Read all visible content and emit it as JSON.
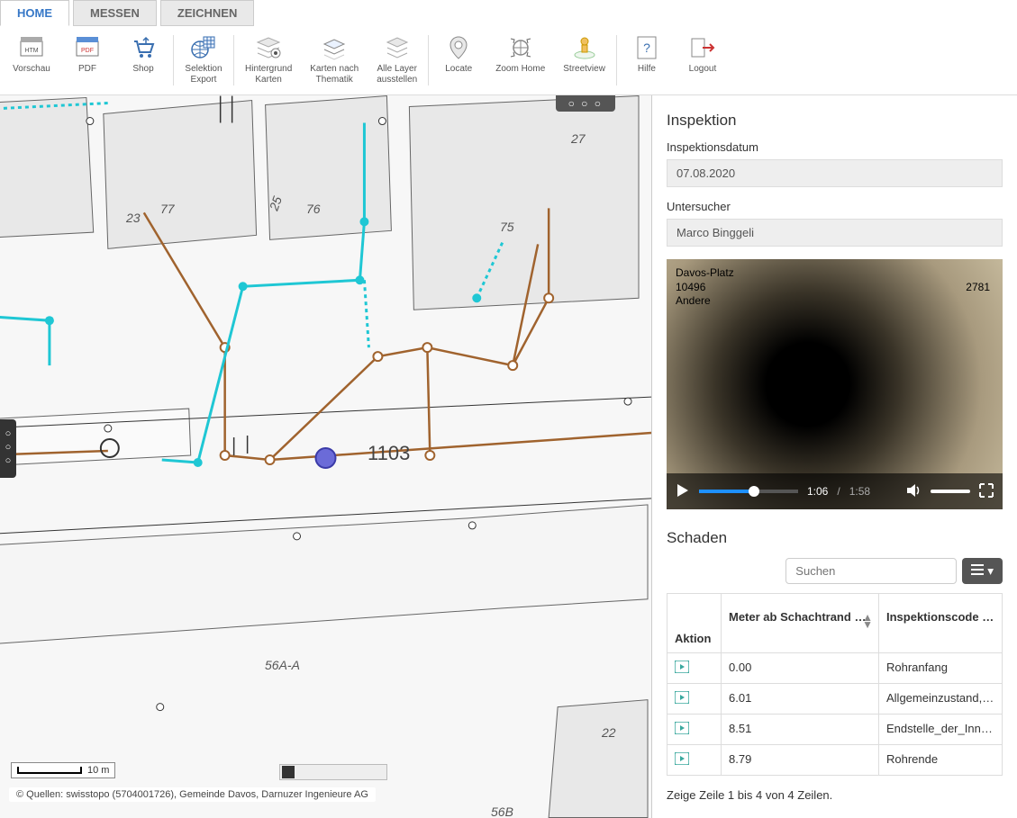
{
  "tabs": {
    "home": "HOME",
    "messen": "MESSEN",
    "zeichnen": "ZEICHNEN"
  },
  "toolbar": {
    "vorschau": "Vorschau",
    "pdf": "PDF",
    "shop": "Shop",
    "selektion": "Selektion\nExport",
    "hintergrund": "Hintergrund\nKarten",
    "karten_nach": "Karten nach\nThematik",
    "alle_layer": "Alle Layer\nausstellen",
    "locate": "Locate",
    "zoom_home": "Zoom Home",
    "streetview": "Streetview",
    "hilfe": "Hilfe",
    "logout": "Logout"
  },
  "map": {
    "feature_id": "1103",
    "parcels": {
      "p23": "23",
      "p77": "77",
      "p25": "25",
      "p76": "76",
      "p75": "75",
      "p27": "27",
      "p56a": "56A-A",
      "p56b": "56B",
      "p22": "22"
    },
    "scale": "10 m",
    "credits": "© Quellen: swisstopo (5704001726), Gemeinde Davos, Darnuzer Ingenieure AG"
  },
  "inspektion": {
    "title": "Inspektion",
    "datum_label": "Inspektionsdatum",
    "datum_value": "07.08.2020",
    "untersucher_label": "Untersucher",
    "untersucher_value": "Marco Binggeli"
  },
  "video": {
    "loc1": "Davos-Platz",
    "loc2": "10496",
    "loc3": "Andere",
    "right": "2781",
    "current": "1:06",
    "total": "1:58"
  },
  "schaden": {
    "title": "Schaden",
    "search_placeholder": "Suchen",
    "col_aktion": "Aktion",
    "col_meter": "Meter ab Schachtrand",
    "col_code": "Inspektionscode",
    "rows": [
      {
        "meter": "0.00",
        "code": "Rohranfang"
      },
      {
        "meter": "6.01",
        "code": "Allgemeinzustand,_Fo"
      },
      {
        "meter": "8.51",
        "code": "Endstelle_der_Innena"
      },
      {
        "meter": "8.79",
        "code": "Rohrende"
      }
    ],
    "footer": "Zeige Zeile 1 bis 4 von 4 Zeilen."
  }
}
